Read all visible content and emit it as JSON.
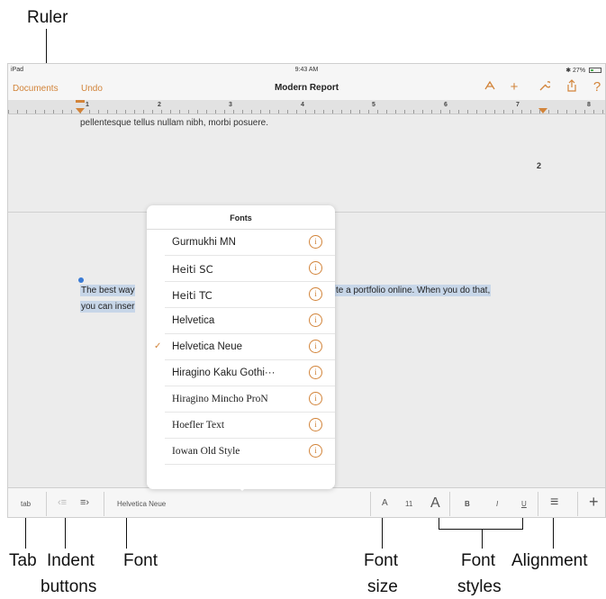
{
  "callouts": {
    "ruler": "Ruler",
    "tab": "Tab",
    "indent_1": "Indent",
    "indent_2": "buttons",
    "font": "Font",
    "font_size_1": "Font",
    "font_size_2": "size",
    "font_styles_1": "Font",
    "font_styles_2": "styles",
    "alignment": "Alignment"
  },
  "status_bar": {
    "device": "iPad",
    "time": "9:43 AM",
    "battery": "27%"
  },
  "toolbar": {
    "documents": "Documents",
    "undo": "Undo",
    "title": "Modern Report"
  },
  "ruler": {
    "numbers": [
      "1",
      "2",
      "3",
      "4",
      "5",
      "6",
      "7",
      "8"
    ]
  },
  "document": {
    "top_text": "pellentesque tellus nullam nibh, morbi posuere.",
    "page_number": "2",
    "selected_line1_left": "The best way",
    "selected_line1_right": "te a portfolio online. When you do that,",
    "selected_line2_left": "you can inser"
  },
  "fonts_popover": {
    "title": "Fonts",
    "items": [
      {
        "name": "Gurmukhi MN",
        "checked": false
      },
      {
        "name": "Heiti SC",
        "checked": false
      },
      {
        "name": "Heiti TC",
        "checked": false
      },
      {
        "name": "Helvetica",
        "checked": false
      },
      {
        "name": "Helvetica Neue",
        "checked": true
      },
      {
        "name": "Hiragino Kaku Gothi···",
        "checked": false
      },
      {
        "name": "Hiragino Mincho ProN",
        "checked": false
      },
      {
        "name": "Hoefler Text",
        "checked": false
      },
      {
        "name": "Iowan Old Style",
        "checked": false
      }
    ],
    "info_glyph": "i",
    "check_glyph": "✓"
  },
  "format_bar": {
    "tab": "tab",
    "font_name": "Helvetica Neue",
    "size_small_a": "A",
    "font_size": "11",
    "size_large_a": "A",
    "bold": "B",
    "italic": "I",
    "underline": "U",
    "align_icon": "≡",
    "add_icon": "+"
  },
  "colors": {
    "accent": "#d2843a",
    "selection": "#c7d6e8",
    "background": "#ececec"
  }
}
